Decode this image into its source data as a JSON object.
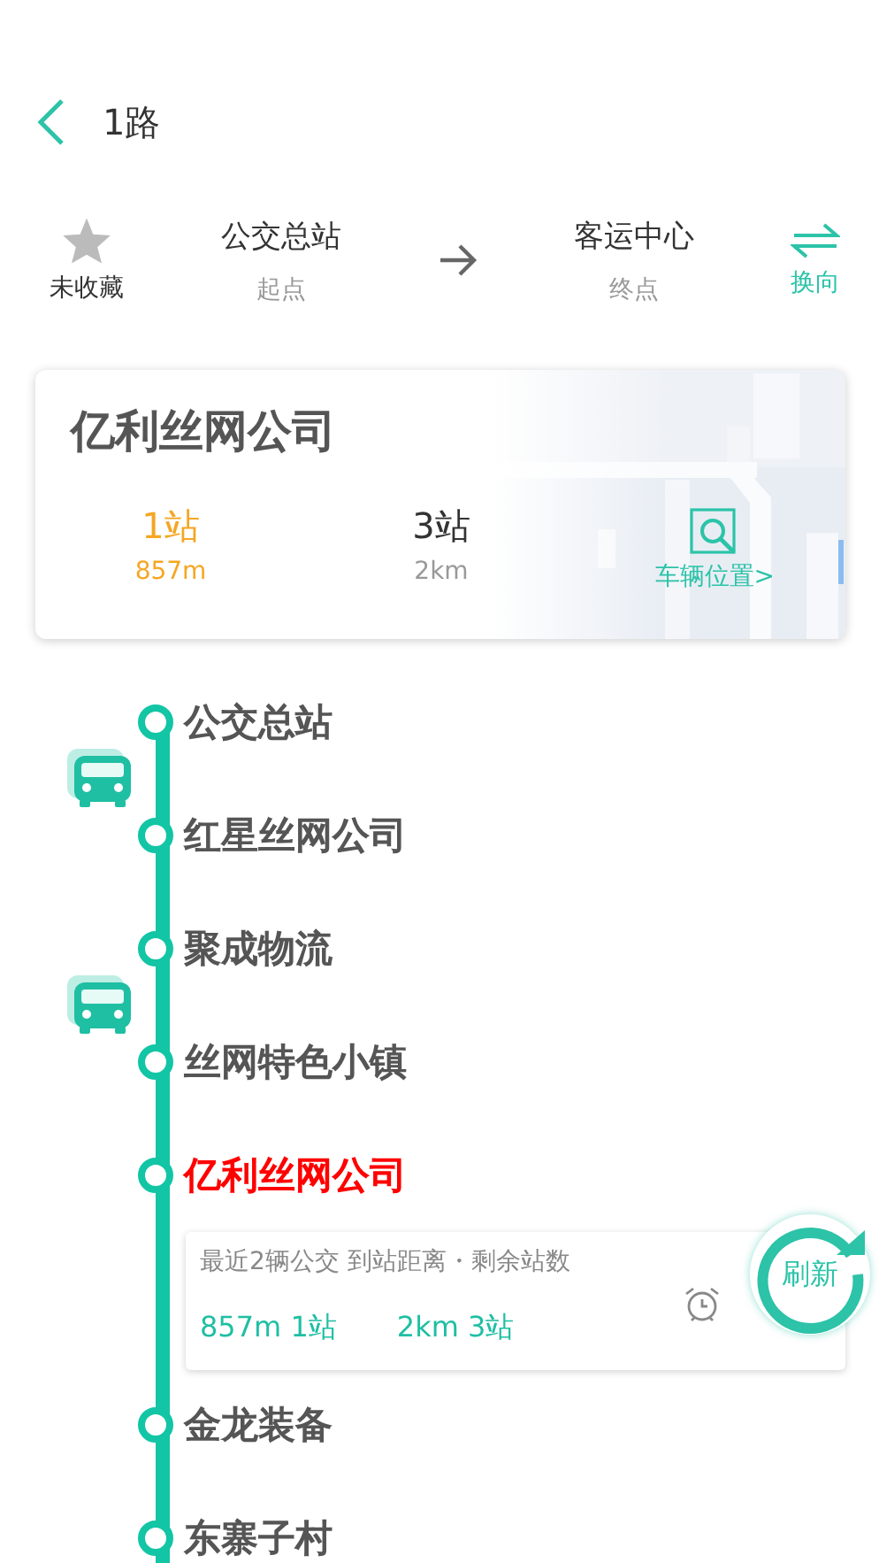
{
  "header": {
    "title": "1路"
  },
  "route": {
    "favorite": {
      "label": "未收藏",
      "on": false
    },
    "start": {
      "name": "公交总站",
      "caption": "起点"
    },
    "end": {
      "name": "客运中心",
      "caption": "终点"
    },
    "swap": {
      "label": "换向"
    }
  },
  "card": {
    "station": "亿利丝网公司",
    "arrivals": [
      {
        "stops": "1站",
        "distance": "857m",
        "kind": "near"
      },
      {
        "stops": "3站",
        "distance": "2km",
        "kind": "far"
      }
    ],
    "map": {
      "kind": "picture",
      "link": "车辆位置>"
    }
  },
  "stops": [
    {
      "name": "公交总站",
      "selected": false,
      "bus_after": true
    },
    {
      "name": "红星丝网公司",
      "selected": false,
      "bus_after": false
    },
    {
      "name": "聚成物流",
      "selected": false,
      "bus_after": true
    },
    {
      "name": "丝网特色小镇",
      "selected": false,
      "bus_after": false
    },
    {
      "name": "亿利丝网公司",
      "selected": true
    },
    {
      "name": "金龙装备",
      "selected": false,
      "bus_after": false
    },
    {
      "name": "东寨子村",
      "selected": false
    }
  ],
  "panel": {
    "caption": "最近2辆公交 到站距离・剩余站数",
    "buses": [
      "857m 1站",
      "2km 3站"
    ],
    "refresh": "刷新"
  }
}
